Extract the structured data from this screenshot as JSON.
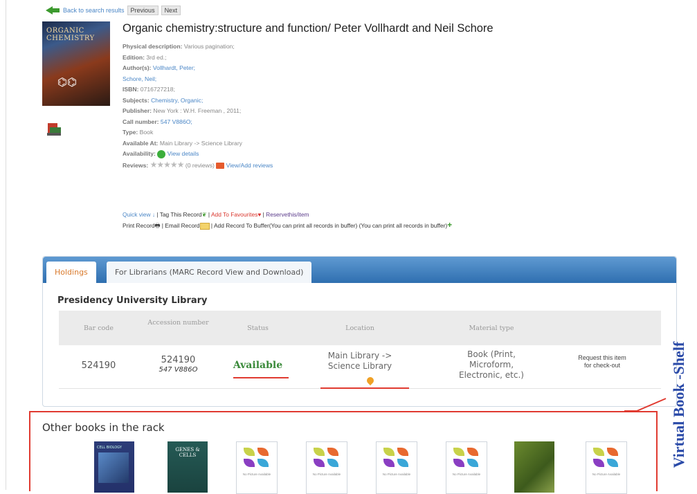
{
  "nav": {
    "back_label": "Back to search results",
    "previous_label": "Previous",
    "next_label": "Next"
  },
  "book": {
    "title": "Organic chemistry:structure and function/ Peter Vollhardt and Neil Schore",
    "cover_text": "ORGANIC CHEMISTRY",
    "fields": {
      "physical_label": "Physical description:",
      "physical_value": "Various pagination;",
      "edition_label": "Edition:",
      "edition_value": "3rd ed.;",
      "authors_label": "Author(s):",
      "author1": "Vollhardt, Peter;",
      "author2": "Schore, Neil;",
      "isbn_label": "ISBN:",
      "isbn_value": "0716727218;",
      "subjects_label": "Subjects:",
      "subjects_value": "Chemistry, Organic;",
      "publisher_label": "Publisher:",
      "publisher_value": "New York : W.H. Freeman , 2011;",
      "call_label": "Call number:",
      "call_value": "547 V886O;",
      "type_label": "Type:",
      "type_value": "Book",
      "available_at_label": "Available At:",
      "available_at_value": "Main Library -> Science Library",
      "availability_label": "Availability:",
      "availability_link": "View details",
      "reviews_label": "Reviews:",
      "reviews_count": "(0 reviews)",
      "reviews_link": "View/Add reviews"
    }
  },
  "actions": {
    "quick_view": "Quick view ↓",
    "tag": "Tag This Record",
    "favourites": "Add To Favourites",
    "reserve": "Reservethis/item",
    "print": "Print Record",
    "email": "Email Record",
    "buffer": "Add Record To Buffer(You can print all records in buffer) (You can print all records in buffer)",
    "sep": "|"
  },
  "holdings": {
    "tabs": [
      "Holdings",
      "For Librarians (MARC Record View and Download)"
    ],
    "library_name": "Presidency University Library",
    "columns": [
      "Bar code",
      "Accession number",
      "Status",
      "Location",
      "Material type"
    ],
    "row": {
      "barcode": "524190",
      "accession": "524190",
      "accession_call": "547 V886O",
      "status": "Available",
      "location": "Main Library -> Science Library",
      "material": "Book (Print, Microform, Electronic, etc.)",
      "request": "Request this item for check-out"
    }
  },
  "rack": {
    "title": "Other books in the rack",
    "book1_cover": "CELL BIOLOGY",
    "book2_cover": "GENES & CELLS",
    "no_picture": "No Picture Available"
  },
  "annotation": {
    "virtual_shelf": "Virtual Book -Shelf"
  },
  "colors": {
    "accent_blue": "#2f6fb0",
    "link_blue": "#4a86c6",
    "status_green": "#3a8a3a",
    "annotation_red": "#e03a30",
    "annotation_blue": "#2a4aa8"
  }
}
